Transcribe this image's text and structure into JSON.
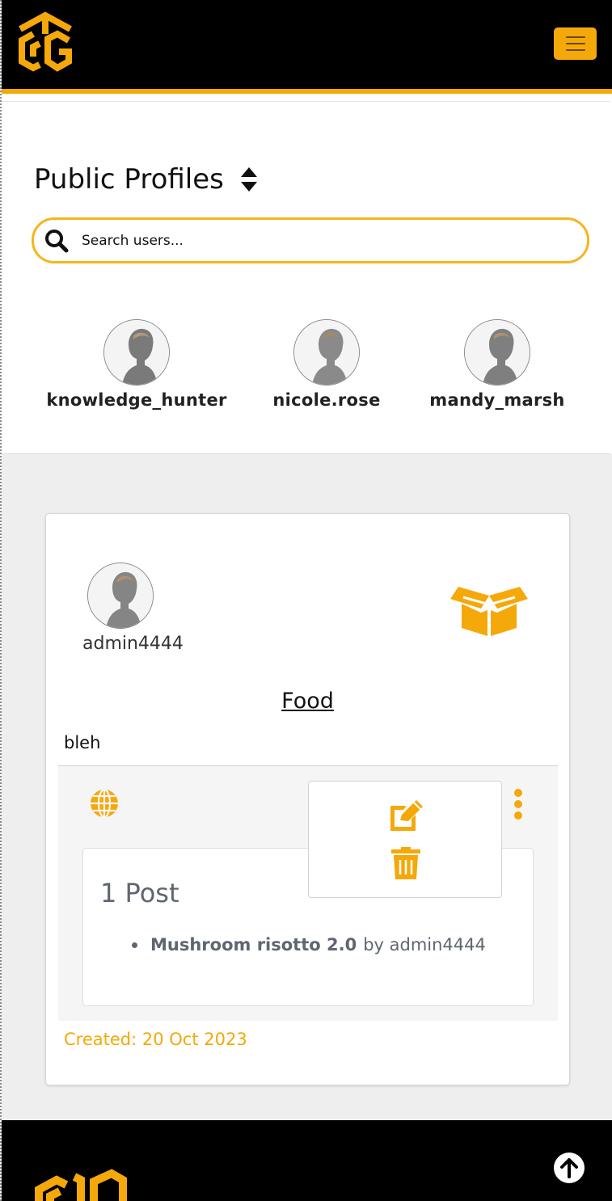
{
  "header": {
    "logo_icon": "cube-cg-logo-icon",
    "menu_icon": "hamburger-icon"
  },
  "profiles_section": {
    "title": "Public Profiles",
    "sort_icon": "sort-icon",
    "search": {
      "placeholder": "Search users...",
      "value": ""
    },
    "users": [
      {
        "username": "knowledge_hunter"
      },
      {
        "username": "nicole.rose"
      },
      {
        "username": "mandy_marsh"
      }
    ]
  },
  "collection_card": {
    "owner": "admin4444",
    "title": "Food",
    "description": "bleh",
    "visibility_icon": "globe-icon",
    "category_icon": "open-box-icon",
    "actions_menu": {
      "edit_icon": "edit-icon",
      "delete_icon": "trash-icon"
    },
    "posts": {
      "count_label": "1 Post",
      "items": [
        {
          "title": "Mushroom risotto 2.0",
          "by": "by admin4444"
        }
      ]
    },
    "created": "Created: 20 Oct 2023"
  },
  "footer": {
    "back_to_top_icon": "arrow-up-icon"
  },
  "colors": {
    "accent": "#f5a80a",
    "header_bg": "#000000",
    "page_bg": "#efeeee",
    "muted_text": "#5f6670"
  }
}
